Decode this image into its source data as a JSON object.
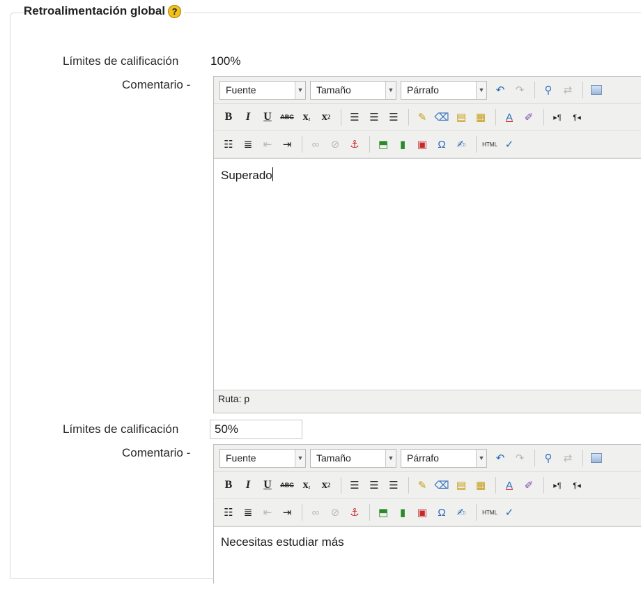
{
  "section": {
    "title": "Retroalimentación global"
  },
  "feedback_items": [
    {
      "limit_label": "Límites de calificación",
      "limit_value": "100%",
      "comment_label": "Comentario -",
      "editor": {
        "font_select": "Fuente",
        "size_select": "Tamaño",
        "format_select": "Párrafo",
        "content": "Superado",
        "path_label": "Ruta: p"
      }
    },
    {
      "limit_label": "Límites de calificación",
      "limit_value": "50%",
      "comment_label": "Comentario -",
      "editor": {
        "font_select": "Fuente",
        "size_select": "Tamaño",
        "format_select": "Párrafo",
        "content": "Necesitas estudiar más"
      }
    }
  ],
  "icons": {
    "help": "question-circle-icon",
    "toolbar_row1": [
      "undo-icon",
      "redo-icon",
      "find-icon",
      "replace-icon",
      "fullscreen-icon"
    ],
    "toolbar_row2": [
      "bold-icon",
      "italic-icon",
      "underline-icon",
      "strikethrough-icon",
      "subscript-icon",
      "superscript-icon",
      "align-left-icon",
      "align-center-icon",
      "align-right-icon",
      "cleanup-icon",
      "remove-format-icon",
      "paste-text-icon",
      "paste-word-icon",
      "text-color-icon",
      "background-color-icon",
      "ltr-icon",
      "rtl-icon"
    ],
    "toolbar_row3": [
      "bullet-list-icon",
      "numbered-list-icon",
      "outdent-icon",
      "indent-icon",
      "link-icon",
      "unlink-icon",
      "anchor-icon",
      "image-icon",
      "media-icon",
      "emoticon-icon",
      "special-char-icon",
      "spellcheck-icon",
      "html-source-icon",
      "spell-icon"
    ]
  },
  "colors": {
    "help_icon": "#f3c11b",
    "editor_bg": "#f0f0ee"
  }
}
